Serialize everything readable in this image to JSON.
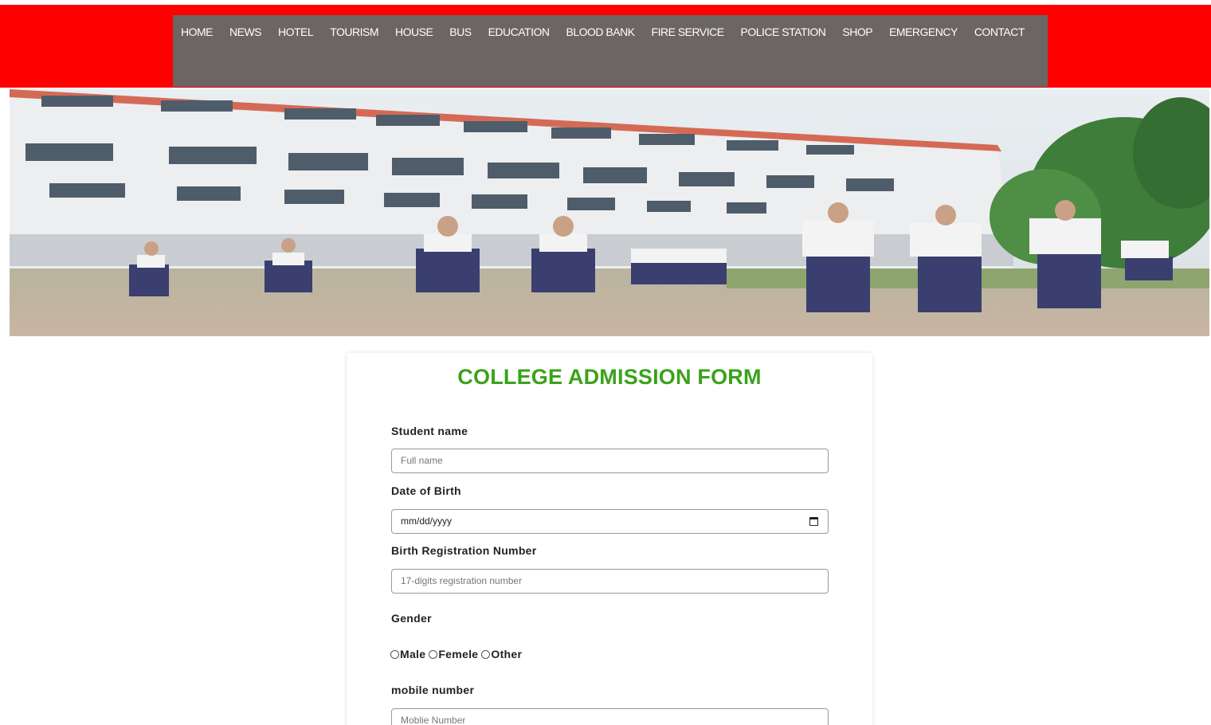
{
  "nav": {
    "items": [
      "HOME",
      "NEWS",
      "HOTEL",
      "TOURISM",
      "HOUSE",
      "BUS",
      "EDUCATION",
      "BLOOD BANK",
      "FIRE SERVICE",
      "POLICE STATION",
      "SHOP",
      "EMERGENCY",
      "CONTACT"
    ]
  },
  "colors": {
    "topbar": "#ff0000",
    "nav_bg": "#6b6563",
    "title": "#3aa21a"
  },
  "form": {
    "title": "COLLEGE ADMISSION FORM",
    "student_name_label": "Student name",
    "student_name_placeholder": "Full name",
    "dob_label": "Date of Birth",
    "dob_value": "mm/dd/yyyy",
    "birth_reg_label": "Birth Registration Number",
    "birth_reg_placeholder": "17-digits registration number",
    "gender_label": "Gender",
    "gender_options": [
      "Male",
      "Femele",
      "Other"
    ],
    "mobile_label": "mobile number",
    "mobile_placeholder": "Moblie Number"
  }
}
